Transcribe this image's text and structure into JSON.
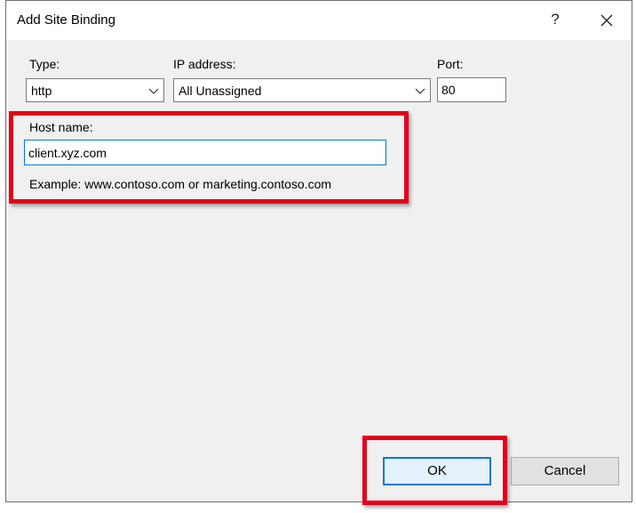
{
  "window": {
    "title": "Add Site Binding",
    "help_glyph": "?",
    "icons": {
      "help": "question-mark-icon",
      "close": "close-icon",
      "dropdown": "chevron-down-icon"
    }
  },
  "binding": {
    "type_label": "Type:",
    "type_value": "http",
    "ip_label": "IP address:",
    "ip_value": "All Unassigned",
    "port_label": "Port:",
    "port_value": "80",
    "host_label": "Host name:",
    "host_value": "client.xyz.com",
    "example_text": "Example: www.contoso.com or marketing.contoso.com"
  },
  "buttons": {
    "ok_label": "OK",
    "cancel_label": "Cancel"
  },
  "colors": {
    "highlight": "#e3001b",
    "focus": "#0078d7",
    "dialog_bg": "#f0f0f0"
  }
}
